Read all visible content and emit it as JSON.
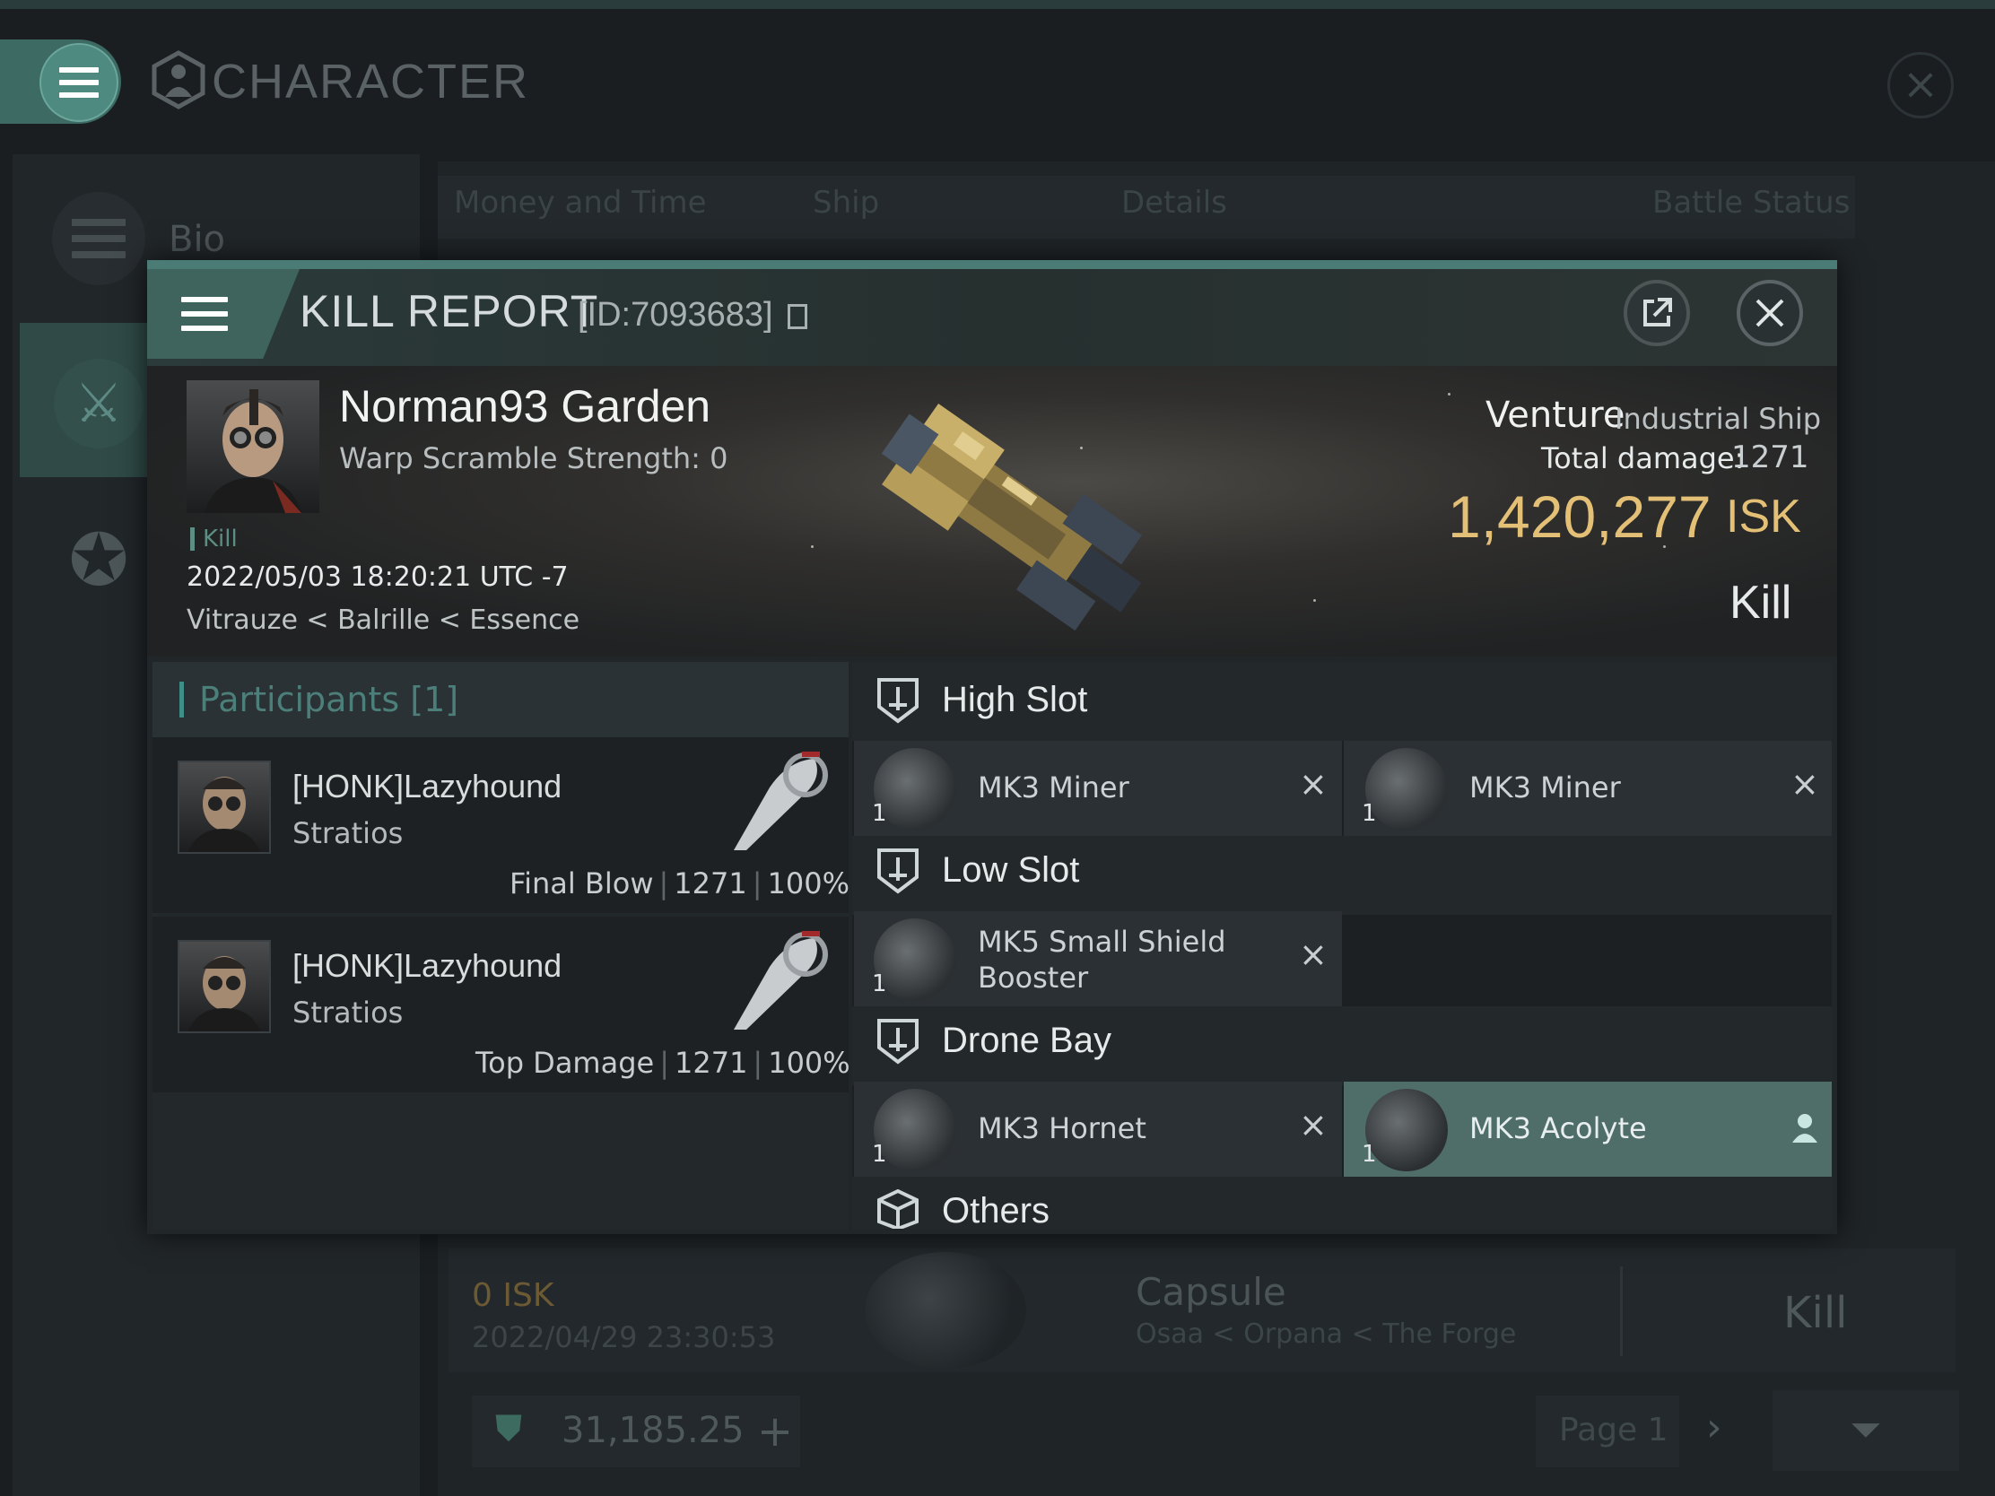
{
  "background": {
    "window_title": "CHARACTER",
    "sidebar_bio_label": "Bio",
    "tabs": [
      "Money and Time",
      "Ship",
      "Details",
      "Battle Status"
    ],
    "list_row": {
      "isk": "0  ISK",
      "date": "2022/04/29  23:30:53",
      "ship": "Capsule",
      "location": "Osaa < Orpana < The Forge",
      "result": "Kill"
    },
    "wallet_amount": "31,185.25",
    "page_label": "Page 1"
  },
  "modal": {
    "title": "KILL REPORT",
    "id_text": "[ID:7093683]",
    "victim": {
      "name": "Norman93 Garden",
      "warp_scramble": "Warp Scramble Strength: 0",
      "tag": "Kill",
      "datetime": "2022/05/03 18:20:21 UTC -7",
      "location": "Vitrauze < Balrille < Essence"
    },
    "ship": {
      "name": "Venture",
      "class": "Industrial Ship",
      "damage_label": "Total damage:",
      "damage_value": "1271",
      "isk_value": "1,420,277",
      "isk_unit": "ISK",
      "result": "Kill"
    },
    "participants": {
      "label": "Participants [1]",
      "rows": [
        {
          "name": "[HONK]Lazyhound",
          "ship": "Stratios",
          "role": "Final Blow",
          "damage": "1271",
          "percent": "100%"
        },
        {
          "name": "[HONK]Lazyhound",
          "ship": "Stratios",
          "role": "Top Damage",
          "damage": "1271",
          "percent": "100%"
        }
      ]
    },
    "fitting": {
      "high_slot": {
        "label": "High Slot",
        "modules": [
          {
            "qty": "1",
            "name": "MK3 Miner",
            "status": "×"
          },
          {
            "qty": "1",
            "name": "MK3 Miner",
            "status": "×"
          }
        ]
      },
      "low_slot": {
        "label": "Low Slot",
        "modules": [
          {
            "qty": "1",
            "name": "MK5 Small Shield Booster",
            "status": "×"
          }
        ]
      },
      "drone_bay": {
        "label": "Drone Bay",
        "modules": [
          {
            "qty": "1",
            "name": "MK3  Hornet",
            "status": "×"
          },
          {
            "qty": "1",
            "name": "MK3  Acolyte",
            "status": "dropped"
          }
        ]
      },
      "others": {
        "label": "Others"
      }
    }
  },
  "colors": {
    "accent_teal": "#4a7c75",
    "isk_gold": "#e4c076",
    "active_module": "#4f6e6a"
  }
}
